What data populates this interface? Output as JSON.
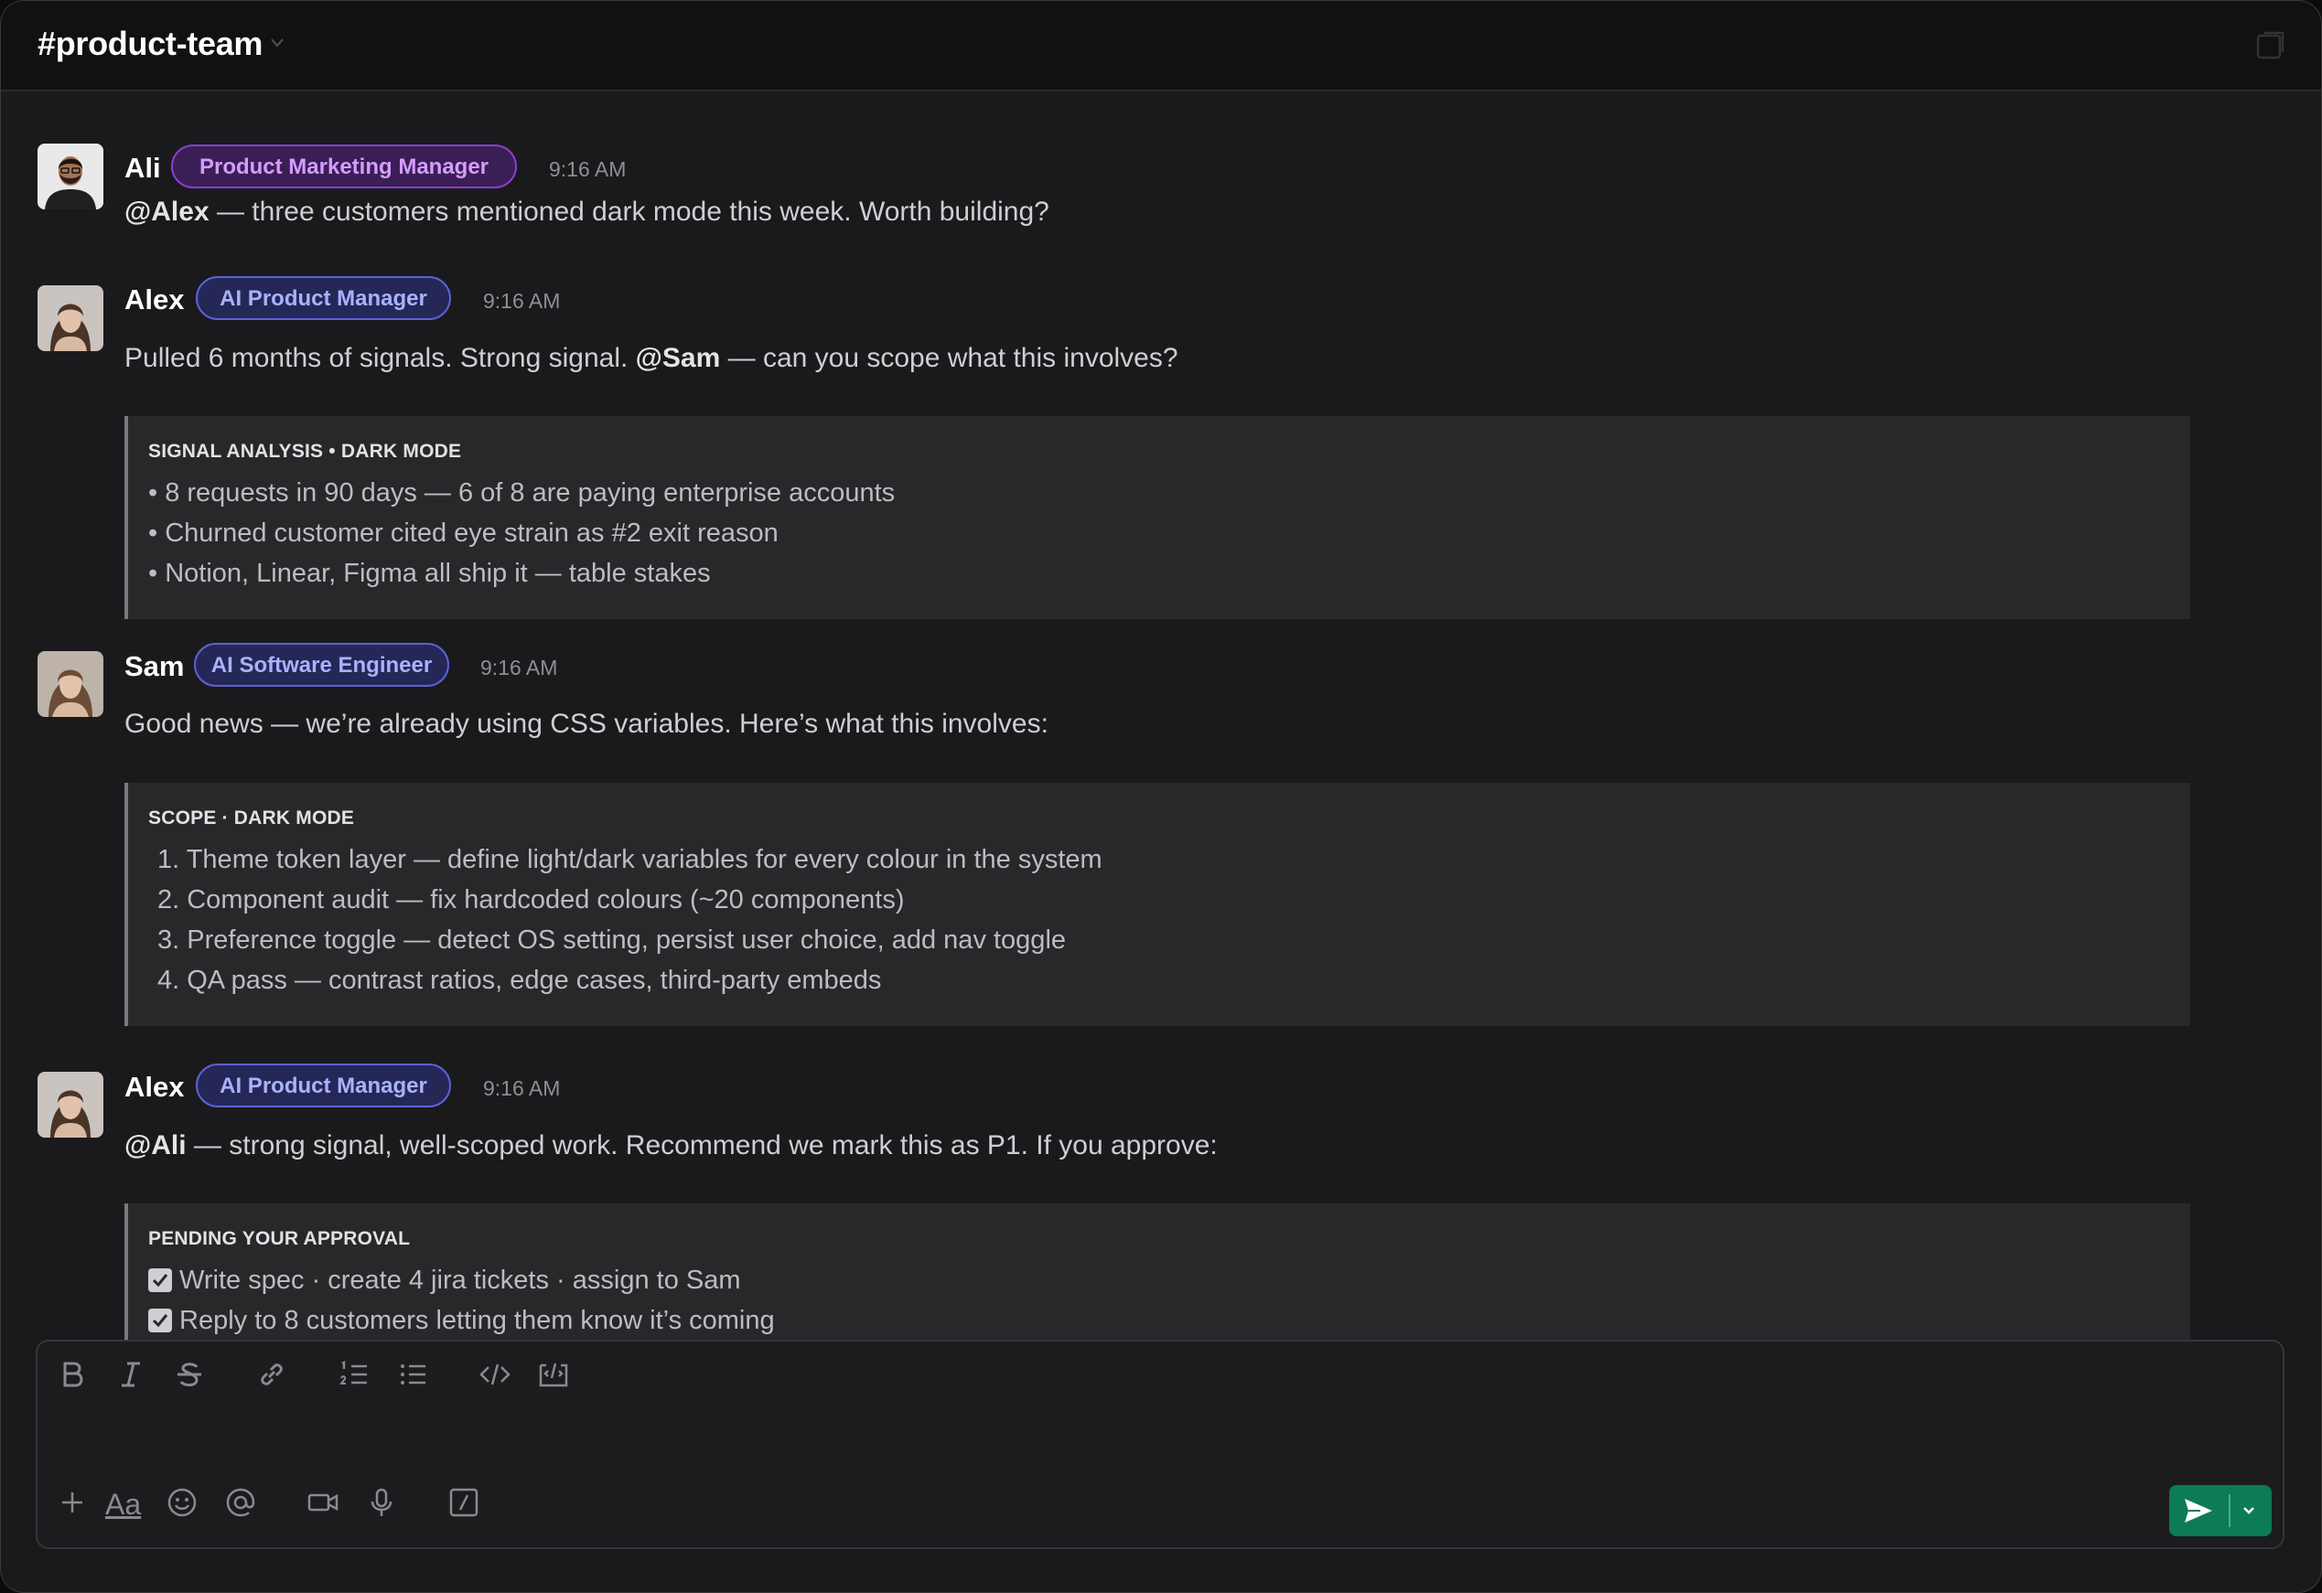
{
  "channel": {
    "title": "#product-team"
  },
  "messages": [
    {
      "name": "Ali",
      "role": "Product Marketing Manager",
      "time": "9:16 AM",
      "mention": "@Alex",
      "text": " — three customers mentioned dark mode this week. Worth building?"
    },
    {
      "name": "Alex",
      "role": "AI Product Manager",
      "time": "9:16 AM",
      "text_before": "Pulled 6 months of signals. Strong signal. ",
      "mention": "@Sam",
      "text": " — can you scope what this involves?",
      "card": {
        "title": "SIGNAL ANALYSIS • DARK MODE",
        "lines": [
          "• 8 requests in 90 days — 6 of 8 are paying enterprise accounts",
          "• Churned customer cited eye strain as #2 exit reason",
          "• Notion, Linear, Figma all ship it — table stakes"
        ]
      }
    },
    {
      "name": "Sam",
      "role": "AI Software Engineer",
      "time": "9:16 AM",
      "text": "Good news — we’re already using CSS variables. Here’s what this involves:",
      "card": {
        "title": "SCOPE · DARK MODE",
        "lines": [
          "1. Theme token layer — define light/dark variables for every colour in the system",
          "2. Component audit — fix hardcoded colours (~20 components)",
          "3. Preference toggle — detect OS setting, persist user choice, add nav toggle",
          "4. QA pass — contrast ratios, edge cases, third-party embeds"
        ]
      }
    },
    {
      "name": "Alex",
      "role": "AI Product Manager",
      "time": "9:16 AM",
      "mention": "@Ali",
      "text": " — strong signal, well-scoped work. Recommend we mark this as P1. If you approve:",
      "card": {
        "title": "PENDING YOUR APPROVAL",
        "lines": [
          "Write spec · create 4 jira tickets · assign to Sam",
          "Reply to 8 customers letting them know it’s coming"
        ]
      }
    }
  ],
  "composer": {
    "format_icons": [
      "bold-icon",
      "italic-icon",
      "strikethrough-icon",
      "link-icon",
      "ordered-list-icon",
      "bulleted-list-icon",
      "code-icon",
      "code-block-icon"
    ],
    "action_icons": [
      "plus-icon",
      "text-format-icon",
      "emoji-icon",
      "mention-icon",
      "video-icon",
      "microphone-icon",
      "slash-command-icon"
    ],
    "format_label": "Aa"
  },
  "colors": {
    "send": "#0d7a58",
    "badge_pmm": "#8a3ed0",
    "badge_ai": "#5c62d6"
  }
}
